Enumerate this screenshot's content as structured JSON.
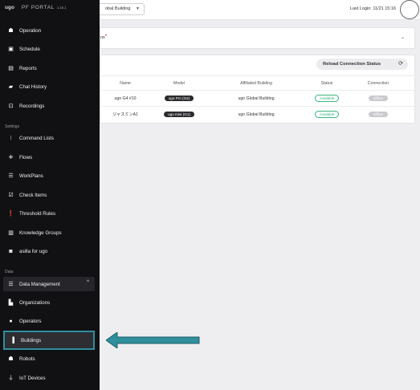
{
  "app": {
    "logo": "ugo",
    "portal": "PF PORTAL",
    "version": "1.16.1",
    "building_select_partial": "obal Building",
    "last_login": "Last Login: 11/21 15:16"
  },
  "sidebar": {
    "section_settings": "Settings",
    "section_data": "Data",
    "items": [
      {
        "label": "Operation",
        "icon": "robot-icon"
      },
      {
        "label": "Schedule",
        "icon": "calendar-icon"
      },
      {
        "label": "Reports",
        "icon": "report-icon"
      },
      {
        "label": "Chat History",
        "icon": "chat-icon"
      },
      {
        "label": "Recordings",
        "icon": "recording-icon"
      },
      {
        "label": "Command Lists",
        "icon": "grid-icon"
      },
      {
        "label": "Flows",
        "icon": "flow-icon"
      },
      {
        "label": "WorkPlans",
        "icon": "workplan-icon"
      },
      {
        "label": "Check Items",
        "icon": "check-icon"
      },
      {
        "label": "Threshold Rules",
        "icon": "alert-icon"
      },
      {
        "label": "Knowledge Groups",
        "icon": "book-icon"
      },
      {
        "label": "asilla for ugo",
        "icon": "camera-icon"
      },
      {
        "label": "Data Management",
        "icon": "database-icon"
      },
      {
        "label": "Organizations",
        "icon": "organization-icon"
      },
      {
        "label": "Operators",
        "icon": "person-icon"
      },
      {
        "label": "Buildings",
        "icon": "building-icon"
      },
      {
        "label": "Robots",
        "icon": "robot-icon"
      },
      {
        "label": "IoT Devices",
        "icon": "iot-icon"
      }
    ]
  },
  "main": {
    "panel1_title_partial": "ns",
    "reload_label": "Reload Connection Status",
    "columns": [
      "Name",
      "Model",
      "Affiliated Building",
      "Status",
      "Connection"
    ],
    "rows": [
      {
        "name": "ugo G4 #10",
        "model": "ugo Pro (G4)",
        "building": "ugo Global Building",
        "status": "Available",
        "connection": "Offline"
      },
      {
        "name": "ジャスミンA1",
        "model": "ugo mini (G1)",
        "building": "ugo Global Building",
        "status": "Available",
        "connection": "Offline"
      }
    ]
  },
  "colors": {
    "sidebar_bg": "#111113",
    "highlight": "#2f8f9c",
    "status_green": "#36b37e"
  }
}
